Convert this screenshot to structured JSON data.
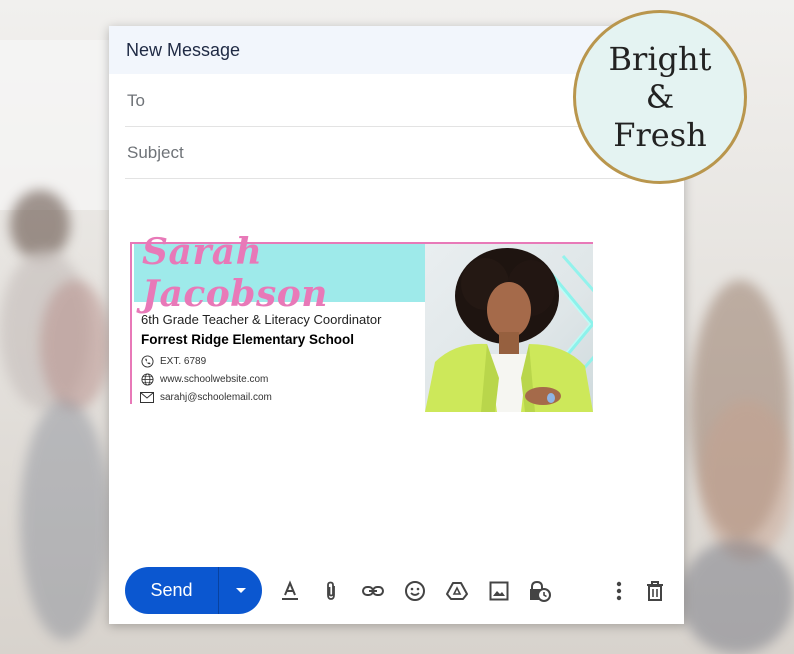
{
  "compose": {
    "title": "New Message",
    "to_placeholder": "To",
    "subject_placeholder": "Subject"
  },
  "signature": {
    "name": "Sarah Jacobson",
    "job_title": "6th Grade Teacher & Literacy Coordinator",
    "school": "Forrest Ridge Elementary School",
    "extension": "EXT. 6789",
    "website": "www.schoolwebsite.com",
    "email": "sarahj@schoolemail.com",
    "colors": {
      "name": "#e879b8",
      "band": "#9eeaea",
      "border": "#e879b8"
    }
  },
  "badge": {
    "line1": "Bright",
    "line2": "&",
    "line3": "Fresh"
  },
  "toolbar": {
    "send_label": "Send",
    "icons": [
      "format-text-icon",
      "attach-icon",
      "link-icon",
      "emoji-icon",
      "drive-icon",
      "image-icon",
      "confidential-mode-icon",
      "more-options-icon",
      "trash-icon"
    ]
  },
  "colors": {
    "accent": "#0b57d0",
    "header_bg": "#f2f6fc",
    "badge_border": "#b9964d",
    "badge_fill": "#e4f3f2"
  }
}
